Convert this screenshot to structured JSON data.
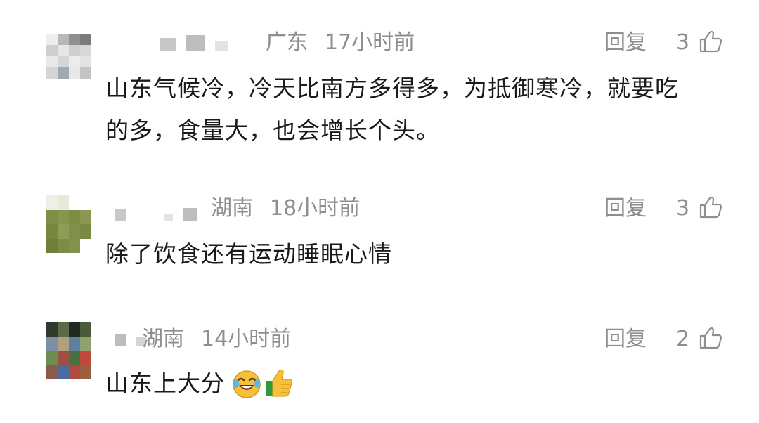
{
  "comments": [
    {
      "location": "广东",
      "time": "17小时前",
      "reply_label": "回复",
      "likes": "3",
      "text_line1": "山东气候冷，冷天比南方多得多，为抵御寒冷，就要吃",
      "text_line2": "的多，食量大，也会增长个头。"
    },
    {
      "location": "湖南",
      "time": "18小时前",
      "reply_label": "回复",
      "likes": "3",
      "text_line1": "除了饮食还有运动睡眠心情"
    },
    {
      "location": "湖南",
      "time": "14小时前",
      "reply_label": "回复",
      "likes": "2",
      "text_line1": "山东上大分",
      "emojis": [
        "laughing-crying-emoji",
        "thumbs-up-emoji"
      ]
    }
  ],
  "icons": {
    "like": "thumbs-up-outline-icon"
  },
  "colors": {
    "meta": "#8e8e8e",
    "text": "#1a1a1a",
    "background": "#ffffff"
  }
}
